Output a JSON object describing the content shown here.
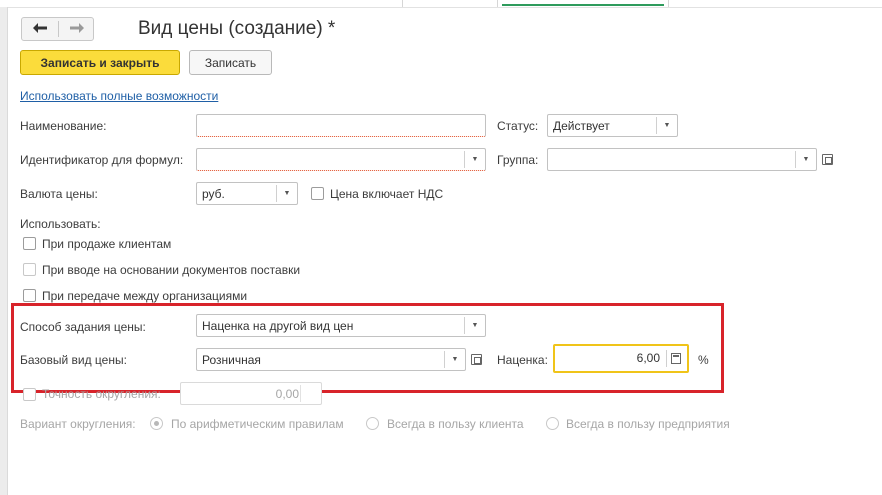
{
  "window": {
    "title": "Вид цены (создание) *"
  },
  "nav": {
    "back_glyph": "🡐",
    "forward_glyph": "🡒"
  },
  "toolbar": {
    "save_close_label": "Записать и закрыть",
    "save_label": "Записать"
  },
  "full_features_link": "Использовать полные возможности",
  "form": {
    "name_label": "Наименование:",
    "name_value": "",
    "status_label": "Статус:",
    "status_value": "Действует",
    "formula_id_label": "Идентификатор для формул:",
    "formula_id_value": "",
    "group_label": "Группа:",
    "group_value": "",
    "currency_label": "Валюта цены:",
    "currency_value": "руб.",
    "vat_label": "Цена включает НДС",
    "use_label": "Использовать:",
    "use_options": [
      {
        "label": "При продаже клиентам",
        "checked": false,
        "enabled": true
      },
      {
        "label": "При вводе на основании документов поставки",
        "checked": false,
        "enabled": false
      },
      {
        "label": "При передаче между организациями",
        "checked": false,
        "enabled": true
      }
    ],
    "price_method_label": "Способ задания цены:",
    "price_method_value": "Наценка на другой вид цен",
    "base_price_label": "Базовый вид цены:",
    "base_price_value": "Розничная",
    "markup_label": "Наценка:",
    "markup_value": "6,00",
    "markup_unit": "%",
    "rounding_precision_label": "Точность округления:",
    "rounding_precision_value": "0,00",
    "rounding_variant_label": "Вариант округления:",
    "rounding_options": [
      {
        "label": "По арифметическим правилам",
        "selected": true
      },
      {
        "label": "Всегда в пользу клиента",
        "selected": false
      },
      {
        "label": "Всегда в пользу предприятия",
        "selected": false
      }
    ]
  },
  "icons": {
    "dropdown": "▼",
    "open": "open-icon",
    "calculator": "calculator-icon"
  },
  "colors": {
    "primary_button": "#fbdc3b",
    "link": "#1f5fa6",
    "highlight_border": "#d8232a",
    "focus_border": "#f0c419"
  }
}
